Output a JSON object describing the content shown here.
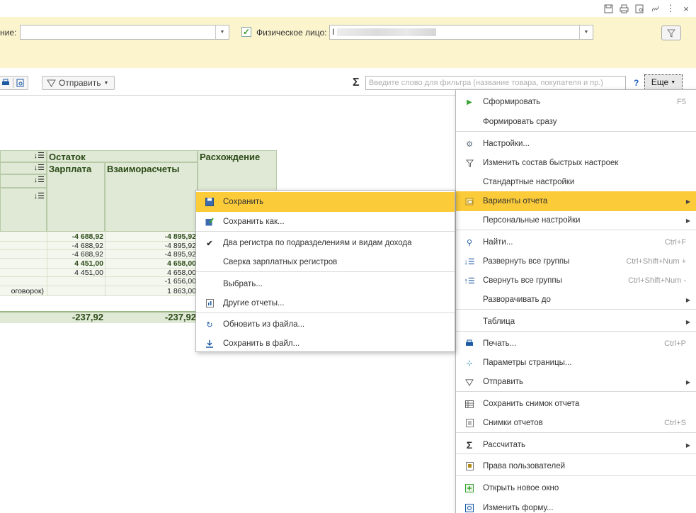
{
  "window_controls": {
    "save_icon": "floppy-icon",
    "print_icon": "printer-icon",
    "preview_icon": "preview-icon",
    "link_icon": "link-icon",
    "more_icon": "kebab-icon",
    "close": "×"
  },
  "filters": {
    "division_label": "ние:",
    "division_value": "",
    "person_checked": true,
    "person_label": "Физическое лицо:",
    "person_value": "I"
  },
  "toolbar": {
    "send_label": "Отправить",
    "sigma": "Σ",
    "search_placeholder": "Введите слово для фильтра (название товара, покупателя и пр.)",
    "help": "?",
    "more_label": "Еще"
  },
  "report": {
    "headers": {
      "balance": "Остаток",
      "salary": "Зарплата",
      "settlements": "Взаиморасчеты",
      "discrepancy": "Расхождение"
    },
    "rows": [
      {
        "label": "",
        "salary": "-4 688,92",
        "settlements": "-4 895,92",
        "bold": true
      },
      {
        "label": "",
        "salary": "-4 688,92",
        "settlements": "-4 895,92",
        "bold": false
      },
      {
        "label": "",
        "salary": "-4 688,92",
        "settlements": "-4 895,92",
        "bold": false
      },
      {
        "label": "",
        "salary": "4 451,00",
        "settlements": "4 658,00",
        "bold": true
      },
      {
        "label": "",
        "salary": "4 451,00",
        "settlements": "4 658,00",
        "bold": false
      },
      {
        "label": "",
        "salary": "",
        "settlements": "-1 656,00",
        "bold": false
      },
      {
        "label": "оговорок)",
        "salary": "",
        "settlements": "1 863,00",
        "bold": false
      }
    ],
    "total": {
      "salary": "-237,92",
      "settlements": "-237,92"
    }
  },
  "more_menu": {
    "items": [
      {
        "label": "Сформировать",
        "shortcut": "F5",
        "icon": "play-icon"
      },
      {
        "label": "Формировать сразу",
        "shortcut": "",
        "icon": ""
      },
      {
        "label": "Настройки...",
        "shortcut": "",
        "icon": "settings-icon"
      },
      {
        "label": "Изменить состав быстрых настроек",
        "shortcut": "",
        "icon": "filter-icon"
      },
      {
        "label": "Стандартные настройки",
        "shortcut": "",
        "icon": ""
      },
      {
        "label": "Варианты отчета",
        "shortcut": "",
        "icon": "report-variants-icon",
        "submenu": true,
        "highlighted": true
      },
      {
        "label": "Персональные настройки",
        "shortcut": "",
        "icon": "",
        "submenu": true
      },
      {
        "label": "Найти...",
        "shortcut": "Ctrl+F",
        "icon": "search-icon"
      },
      {
        "label": "Развернуть все группы",
        "shortcut": "Ctrl+Shift+Num +",
        "icon": "expand-icon"
      },
      {
        "label": "Свернуть все группы",
        "shortcut": "Ctrl+Shift+Num -",
        "icon": "collapse-icon"
      },
      {
        "label": "Разворачивать до",
        "shortcut": "",
        "icon": "",
        "submenu": true
      },
      {
        "label": "Таблица",
        "shortcut": "",
        "icon": "",
        "submenu": true
      },
      {
        "label": "Печать...",
        "shortcut": "Ctrl+P",
        "icon": "printer-icon"
      },
      {
        "label": "Параметры страницы...",
        "shortcut": "",
        "icon": "page-setup-icon"
      },
      {
        "label": "Отправить",
        "shortcut": "",
        "icon": "send-icon",
        "submenu": true
      },
      {
        "label": "Сохранить снимок отчета",
        "shortcut": "",
        "icon": "snapshot-icon"
      },
      {
        "label": "Снимки отчетов",
        "shortcut": "Ctrl+S",
        "icon": "snapshots-icon"
      },
      {
        "label": "Рассчитать",
        "shortcut": "",
        "icon": "sigma-icon",
        "submenu": true
      },
      {
        "label": "Права пользователей",
        "shortcut": "",
        "icon": "user-rights-icon"
      },
      {
        "label": "Открыть новое окно",
        "shortcut": "",
        "icon": "new-window-icon"
      },
      {
        "label": "Изменить форму...",
        "shortcut": "",
        "icon": "form-edit-icon"
      }
    ]
  },
  "variants_submenu": {
    "items": [
      {
        "label": "Сохранить",
        "icon": "floppy-icon",
        "highlighted": true
      },
      {
        "label": "Сохранить как...",
        "icon": "save-as-icon"
      },
      {
        "label": "Два регистра по подразделениям и видам дохода",
        "icon": "check-icon"
      },
      {
        "label": "Сверка зарплатных регистров",
        "icon": ""
      },
      {
        "label": "Выбрать...",
        "icon": ""
      },
      {
        "label": "Другие отчеты...",
        "icon": "reports-icon"
      },
      {
        "label": "Обновить из файла...",
        "icon": "update-file-icon"
      },
      {
        "label": "Сохранить в файл...",
        "icon": "download-icon"
      }
    ]
  },
  "colors": {
    "accent": "#fbcb3a",
    "filter_bg": "#fbf4cd",
    "table_header": "#dfe9d5"
  }
}
